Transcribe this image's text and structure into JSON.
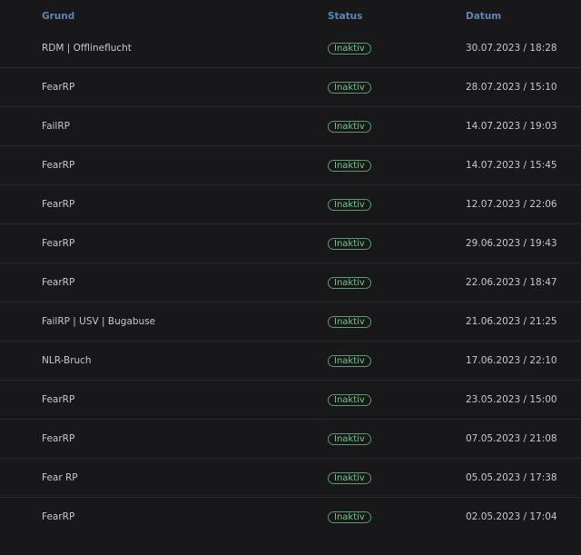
{
  "table": {
    "columns": {
      "grund": "Grund",
      "status": "Status",
      "datum": "Datum"
    },
    "rows": [
      {
        "grund": "RDM | Offlineflucht",
        "status": "Inaktiv",
        "datum": "30.07.2023 / 18:28"
      },
      {
        "grund": "FearRP",
        "status": "Inaktiv",
        "datum": "28.07.2023 / 15:10"
      },
      {
        "grund": "FailRP",
        "status": "Inaktiv",
        "datum": "14.07.2023 / 19:03"
      },
      {
        "grund": "FearRP",
        "status": "Inaktiv",
        "datum": "14.07.2023 / 15:45"
      },
      {
        "grund": "FearRP",
        "status": "Inaktiv",
        "datum": "12.07.2023 / 22:06"
      },
      {
        "grund": "FearRP",
        "status": "Inaktiv",
        "datum": "29.06.2023 / 19:43"
      },
      {
        "grund": "FearRP",
        "status": "Inaktiv",
        "datum": "22.06.2023 / 18:47"
      },
      {
        "grund": "FailRP | USV | Bugabuse",
        "status": "Inaktiv",
        "datum": "21.06.2023 / 21:25"
      },
      {
        "grund": "NLR-Bruch",
        "status": "Inaktiv",
        "datum": "17.06.2023 / 22:10"
      },
      {
        "grund": "FearRP",
        "status": "Inaktiv",
        "datum": "23.05.2023 / 15:00"
      },
      {
        "grund": "FearRP",
        "status": "Inaktiv",
        "datum": "07.05.2023 / 21:08"
      },
      {
        "grund": "Fear RP",
        "status": "Inaktiv",
        "datum": "05.05.2023 / 17:38"
      },
      {
        "grund": "FearRP",
        "status": "Inaktiv",
        "datum": "02.05.2023 / 17:04"
      }
    ]
  },
  "colors": {
    "background": "#18181a",
    "header_text": "#5f86b1",
    "row_text": "#c7c8cc",
    "divider": "#27282b",
    "status_inactive": "#7cc08e"
  }
}
